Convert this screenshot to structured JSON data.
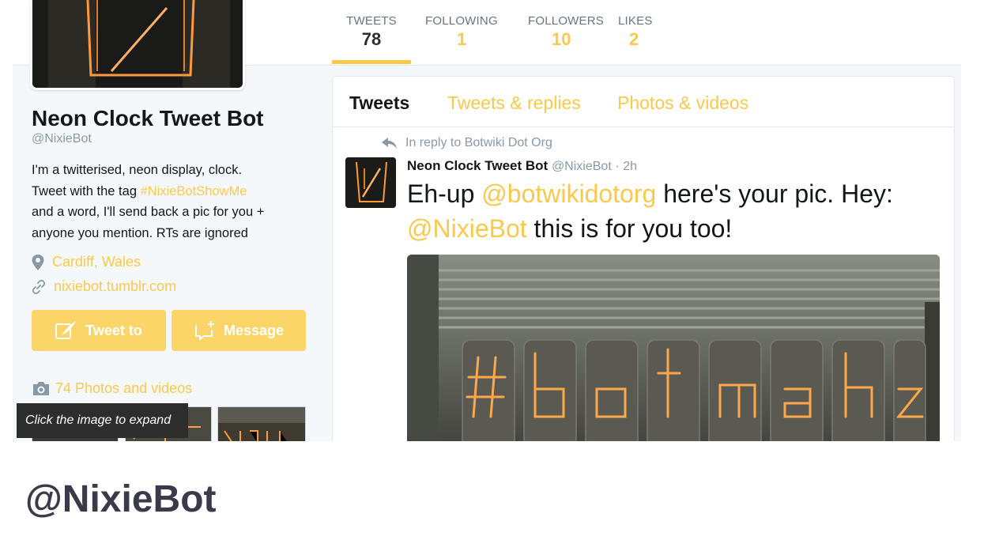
{
  "profile": {
    "name": "Neon Clock Tweet Bot",
    "handle": "@NixieBot",
    "bio_line1": "I'm a twitterised, neon display, clock.",
    "bio_line2_prefix": "Tweet with the tag ",
    "bio_tag": "#NixieBotShowMe",
    "bio_line3": "and a word, I'll send back a pic for you +",
    "bio_line4": "anyone you mention. RTs are ignored",
    "location": "Cardiff, Wales",
    "website": "nixiebot.tumblr.com",
    "tweet_to_label": "Tweet to",
    "message_label": "Message",
    "photos_label": "74 Photos and videos"
  },
  "stats": [
    {
      "label": "TWEETS",
      "value": "78"
    },
    {
      "label": "FOLLOWING",
      "value": "1"
    },
    {
      "label": "FOLLOWERS",
      "value": "10"
    },
    {
      "label": "LIKES",
      "value": "2"
    }
  ],
  "tabs": [
    {
      "label": "Tweets",
      "active": true
    },
    {
      "label": "Tweets & replies"
    },
    {
      "label": "Photos & videos"
    }
  ],
  "tweet": {
    "reply_context": "In reply to Botwiki Dot Org",
    "author_name": "Neon Clock Tweet Bot",
    "author_handle": "@NixieBot",
    "time": "· 2h",
    "text_part1": "Eh-up ",
    "mention1": "@botwikidotorg",
    "text_part2": " here's your pic.  Hey:",
    "mention2": "@NixieBot",
    "text_part3": " this is for you too!"
  },
  "tooltip": "Click the image to expand",
  "caption": "@NixieBot",
  "colors": {
    "accent": "#f9c94c",
    "button": "#fbd568",
    "text": "#14171a",
    "muted": "#8899a6",
    "caption": "#3b3a4a"
  },
  "icons": [
    "reply-arrow-icon",
    "location-pin-icon",
    "link-icon",
    "feather-icon",
    "message-icon",
    "camera-icon"
  ]
}
